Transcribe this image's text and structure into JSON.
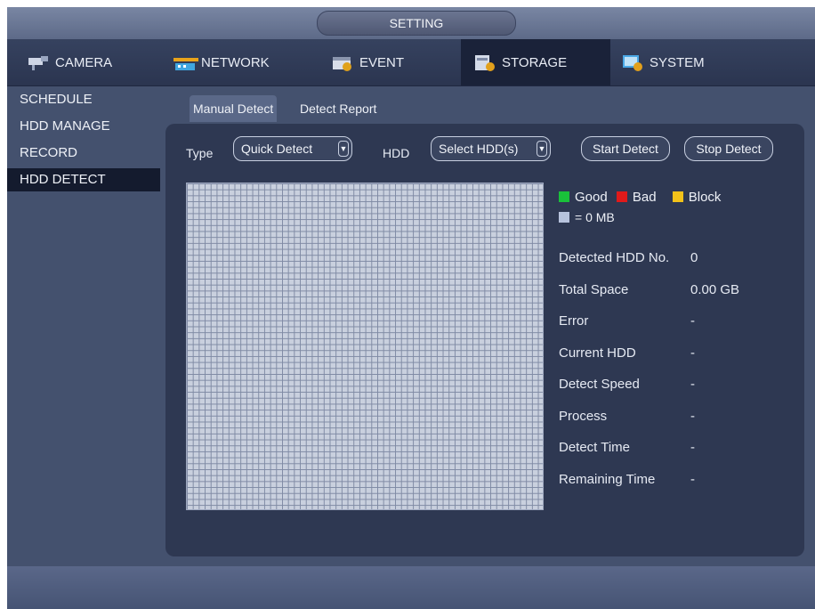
{
  "window": {
    "title": "SETTING"
  },
  "tabs": [
    {
      "label": "CAMERA",
      "icon": "camera-icon"
    },
    {
      "label": "NETWORK",
      "icon": "network-icon"
    },
    {
      "label": "EVENT",
      "icon": "event-icon"
    },
    {
      "label": "STORAGE",
      "icon": "storage-icon",
      "active": true
    },
    {
      "label": "SYSTEM",
      "icon": "system-icon"
    }
  ],
  "menu": [
    {
      "label": "SCHEDULE"
    },
    {
      "label": "HDD MANAGE"
    },
    {
      "label": "RECORD"
    },
    {
      "label": "HDD DETECT",
      "active": true
    }
  ],
  "subtabs": [
    {
      "label": "Manual Detect",
      "active": true
    },
    {
      "label": "Detect Report"
    }
  ],
  "controls": {
    "type_label": "Type",
    "type_value": "Quick Detect",
    "hdd_label": "HDD",
    "hdd_value": "Select HDD(s)",
    "start_label": "Start Detect",
    "stop_label": "Stop Detect"
  },
  "legend": {
    "good": "Good",
    "good_color": "#19c13a",
    "bad": "Bad",
    "bad_color": "#e01a1a",
    "block": "Block",
    "block_color": "#f2c21a",
    "unit": "= 0 MB",
    "unit_color": "#b7c3dd"
  },
  "info": [
    {
      "label": "Detected HDD No.",
      "value": "0"
    },
    {
      "label": "Total Space",
      "value": "0.00 GB"
    },
    {
      "label": "Error",
      "value": "-"
    },
    {
      "label": "Current HDD",
      "value": "-"
    },
    {
      "label": "Detect Speed",
      "value": "-"
    },
    {
      "label": "Process",
      "value": "-"
    },
    {
      "label": "Detect Time",
      "value": "-"
    },
    {
      "label": "Remaining Time",
      "value": "-"
    }
  ]
}
